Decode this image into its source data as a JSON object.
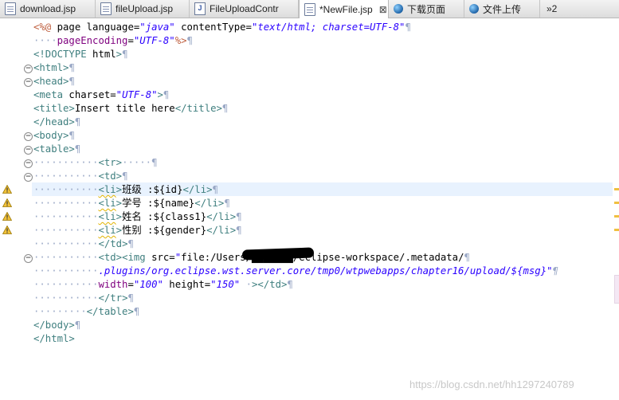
{
  "tabs": [
    {
      "label": "download.jsp",
      "icon": "jsp-file-icon",
      "active": false
    },
    {
      "label": "fileUpload.jsp",
      "icon": "jsp-file-icon",
      "active": false
    },
    {
      "label": "FileUploadContr",
      "icon": "java-file-icon",
      "active": false
    },
    {
      "label": "*NewFile.jsp",
      "icon": "jsp-file-icon",
      "active": true,
      "close": "⊠"
    },
    {
      "label": "下载页面",
      "icon": "globe-icon",
      "active": false
    },
    {
      "label": "文件上传",
      "icon": "globe-icon",
      "active": false
    },
    {
      "label": "»2",
      "icon": "",
      "active": false
    }
  ],
  "code_lines": [
    "<%@ page language=\"java\" contentType=\"text/html; charset=UTF-8\"¶",
    "····pageEncoding=\"UTF-8\"%>¶",
    "<!DOCTYPE html>¶",
    "<html>¶",
    "<head>¶",
    "<meta charset=\"UTF-8\">¶",
    "<title>Insert title here</title>¶",
    "</head>¶",
    "<body>¶",
    "<table>¶",
    "···········<tr>·····¶",
    "···········<td>¶",
    "···········<li>班级 :${id}</li>¶",
    "···········<li>学号 :${name}</li>¶",
    "···········<li>姓名 :${class1}</li>¶",
    "···········<li>性别 :${gender}</li>¶",
    "···········</td>¶",
    "···········<td><img src=\"file:/Users/███████/eclipse-workspace/.metadata/¶",
    "···········.plugins/org.eclipse.wst.server.core/tmp0/wtpwebapps/chapter16/upload/${msg}\"¶",
    "···········width=\"100\" height=\"150\" ·></td>¶",
    "···········</tr>¶",
    "·········</table>¶",
    "</body>¶",
    "</html>"
  ],
  "watermark": "https://blog.csdn.net/hh1297240789",
  "colors": {
    "tag": "#3f7f7f",
    "attribute": "#7f007f",
    "value": "#2a00ff",
    "jsp_directive": "#bf5f3f",
    "whitespace": "#9aa8c6",
    "current_line": "#e8f2fe"
  }
}
